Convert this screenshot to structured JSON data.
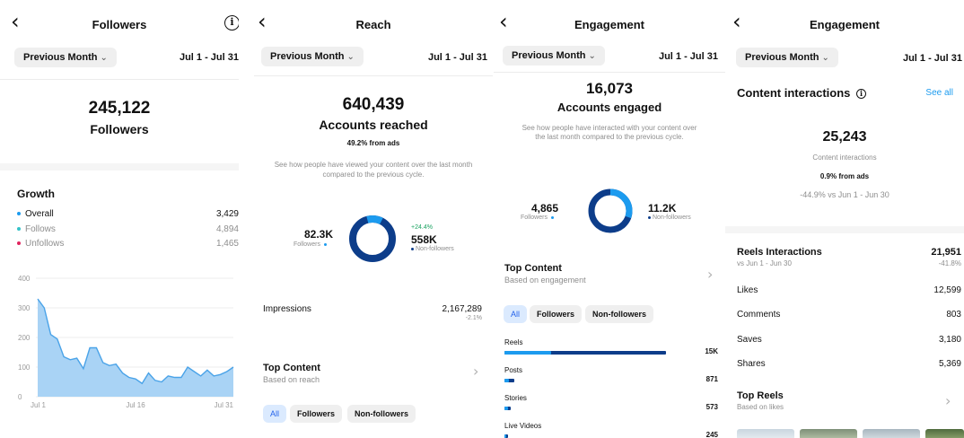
{
  "panel1": {
    "title": "Followers",
    "filter": "Previous Month",
    "date_range": "Jul 1 - Jul 31",
    "total": "245,122",
    "total_label": "Followers",
    "growth_title": "Growth",
    "growth": [
      {
        "label": "Overall",
        "value": "3,429"
      },
      {
        "label": "Follows",
        "value": "4,894"
      },
      {
        "label": "Unfollows",
        "value": "1,465"
      }
    ]
  },
  "panel2": {
    "title": "Reach",
    "filter": "Previous Month",
    "date_range": "Jul 1 - Jul 31",
    "total": "640,439",
    "total_label": "Accounts reached",
    "ads_note": "49.2% from ads",
    "description": "See how people have viewed your content over the last month compared to the previous cycle.",
    "followers_value": "82.3K",
    "followers_label": "Followers",
    "nonfollowers_change": "+24.4%",
    "nonfollowers_value": "558K",
    "nonfollowers_label": "Non-followers",
    "impressions_label": "Impressions",
    "impressions_value": "2,167,289",
    "impressions_change": "-2.1%",
    "top_content_title": "Top Content",
    "top_content_sub": "Based on reach",
    "chips": [
      "All",
      "Followers",
      "Non-followers"
    ]
  },
  "panel3": {
    "title": "Engagement",
    "filter": "Previous Month",
    "date_range": "Jul 1 - Jul 31",
    "total": "16,073",
    "total_label": "Accounts engaged",
    "description": "See how people have interacted with your content over the last month compared to the previous cycle.",
    "followers_value": "4,865",
    "followers_label": "Followers",
    "nonfollowers_value": "11.2K",
    "nonfollowers_label": "Non-followers",
    "top_content_title": "Top Content",
    "top_content_sub": "Based on engagement",
    "chips": [
      "All",
      "Followers",
      "Non-followers"
    ],
    "content_types": [
      {
        "label": "Reels",
        "value": "15K",
        "followers_share": 0.29,
        "total_share": 1.0
      },
      {
        "label": "Posts",
        "value": "871",
        "followers_share": 0.03,
        "total_share": 0.06
      },
      {
        "label": "Stories",
        "value": "573",
        "followers_share": 0.02,
        "total_share": 0.04
      },
      {
        "label": "Live Videos",
        "value": "245",
        "followers_share": 0.01,
        "total_share": 0.02
      }
    ]
  },
  "panel4": {
    "title": "Engagement",
    "filter": "Previous Month",
    "date_range": "Jul 1 - Jul 31",
    "interactions_title": "Content interactions",
    "see_all": "See all",
    "total": "25,243",
    "total_label": "Content interactions",
    "ads_note": "0.9% from ads",
    "comparison": "-44.9% vs Jun 1 - Jun 30",
    "reels_title": "Reels Interactions",
    "reels_sub": "vs Jun 1 - Jun 30",
    "reels_value": "21,951",
    "reels_change": "-41.8%",
    "metrics": [
      {
        "label": "Likes",
        "value": "12,599"
      },
      {
        "label": "Comments",
        "value": "803"
      },
      {
        "label": "Saves",
        "value": "3,180"
      },
      {
        "label": "Shares",
        "value": "5,369"
      }
    ],
    "top_reels_title": "Top Reels",
    "top_reels_sub": "Based on likes"
  },
  "colors": {
    "accent": "#1c9bef",
    "dark_blue": "#0d3d8a",
    "link": "#1c9bef",
    "overall_dot": "#1c9bef",
    "follows_dot": "#35c2c8",
    "unfollows_dot": "#e0245e",
    "area_fill": "#a9d3f5",
    "area_line": "#4aa3e8"
  },
  "chart_data": {
    "type": "area",
    "x": [
      "Jul 1",
      "Jul 2",
      "Jul 3",
      "Jul 4",
      "Jul 5",
      "Jul 6",
      "Jul 7",
      "Jul 8",
      "Jul 9",
      "Jul 10",
      "Jul 11",
      "Jul 12",
      "Jul 13",
      "Jul 14",
      "Jul 15",
      "Jul 16",
      "Jul 17",
      "Jul 18",
      "Jul 19",
      "Jul 20",
      "Jul 21",
      "Jul 22",
      "Jul 23",
      "Jul 24",
      "Jul 25",
      "Jul 26",
      "Jul 27",
      "Jul 28",
      "Jul 29",
      "Jul 30",
      "Jul 31"
    ],
    "values": [
      330,
      300,
      210,
      195,
      135,
      125,
      130,
      95,
      165,
      165,
      115,
      105,
      110,
      80,
      65,
      60,
      45,
      80,
      55,
      50,
      70,
      65,
      65,
      100,
      85,
      70,
      90,
      70,
      75,
      85,
      100
    ],
    "xticks": [
      "Jul 1",
      "Jul 16",
      "Jul 31"
    ],
    "yticks": [
      0,
      100,
      200,
      300,
      400
    ],
    "ylim": [
      0,
      400
    ],
    "grid": true
  }
}
